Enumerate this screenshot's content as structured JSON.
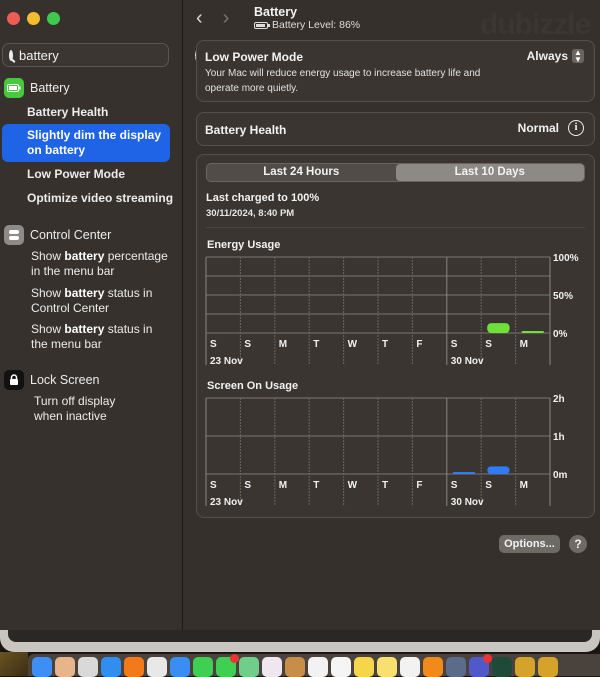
{
  "window": {
    "title": "Battery",
    "subtitle": "Battery Level: 86%",
    "battery_level_percent": 86,
    "traffic_lights": {
      "close": "#ee5c55",
      "minimize": "#f2be2f",
      "zoom": "#3fc94c"
    }
  },
  "sidebar": {
    "search": {
      "value": "battery",
      "placeholder": "Search"
    },
    "sections": [
      {
        "label": "Battery",
        "icon": "battery-icon",
        "icon_color": "#47c93d",
        "items": [
          {
            "label": "Battery Health",
            "selected": false
          },
          {
            "label": "Slightly dim the display on battery",
            "selected": true
          },
          {
            "label": "Low Power Mode",
            "selected": false
          },
          {
            "label": "Optimize video streaming",
            "selected": false
          }
        ]
      },
      {
        "label": "Control Center",
        "icon": "control-center-icon",
        "icon_color": "#8e8a87",
        "items": [
          {
            "pre": "Show ",
            "bold": "battery",
            "post": " percentage in the menu bar"
          },
          {
            "pre": "Show ",
            "bold": "battery",
            "post": " status in Control Center"
          },
          {
            "pre": "Show ",
            "bold": "battery",
            "post": " status in the menu bar"
          }
        ]
      },
      {
        "label": "Lock Screen",
        "icon": "lock-icon",
        "icon_color": "#111111",
        "items": [
          {
            "label": "Turn off display when inactive"
          }
        ]
      }
    ],
    "selected_color": "#1f63e6"
  },
  "low_power": {
    "title": "Low Power Mode",
    "description": "Your Mac will reduce energy usage to increase battery life and operate more quietly.",
    "value": "Always"
  },
  "battery_health": {
    "title": "Battery Health",
    "value": "Normal"
  },
  "usage": {
    "tabs": [
      {
        "label": "Last 24 Hours",
        "active": false
      },
      {
        "label": "Last 10 Days",
        "active": true
      }
    ],
    "last_charged_title": "Last charged to 100%",
    "last_charged_time": "30/11/2024, 8:40 PM"
  },
  "chart_data": [
    {
      "type": "bar",
      "title": "Energy Usage",
      "categories": [
        "S",
        "S",
        "M",
        "T",
        "W",
        "T",
        "F",
        "S",
        "S",
        "M"
      ],
      "date_labels": [
        {
          "index": 0,
          "label": "23 Nov"
        },
        {
          "index": 7,
          "label": "30 Nov"
        }
      ],
      "values": [
        0,
        0,
        0,
        0,
        0,
        0,
        0,
        0,
        13,
        1
      ],
      "unit": "%",
      "y_ticks": [
        "0%",
        "50%",
        "100%"
      ],
      "ylim": [
        0,
        100
      ],
      "color": "#6fe03a",
      "grid": true
    },
    {
      "type": "bar",
      "title": "Screen On Usage",
      "categories": [
        "S",
        "S",
        "M",
        "T",
        "W",
        "T",
        "F",
        "S",
        "S",
        "M"
      ],
      "date_labels": [
        {
          "index": 0,
          "label": "23 Nov"
        },
        {
          "index": 7,
          "label": "30 Nov"
        }
      ],
      "values": [
        0,
        0,
        0,
        0,
        0,
        0,
        0,
        1,
        12,
        0
      ],
      "unit": "minutes",
      "y_ticks": [
        "0m",
        "1h",
        "2h"
      ],
      "ylim": [
        0,
        120
      ],
      "color": "#2f7cf6",
      "grid": true
    }
  ],
  "footer": {
    "options_label": "Options...",
    "help_label": "?"
  },
  "watermark": "dubizzle",
  "dock": {
    "apps": [
      {
        "name": "finder",
        "color": "#3e8ff5"
      },
      {
        "name": "launchpad",
        "color": "#e8b48a"
      },
      {
        "name": "calculator",
        "color": "#d9d9d9"
      },
      {
        "name": "safari",
        "color": "#2f8ef0"
      },
      {
        "name": "firefox",
        "color": "#f27a1a"
      },
      {
        "name": "chrome",
        "color": "#e8e8e8"
      },
      {
        "name": "mail",
        "color": "#3a8ef2"
      },
      {
        "name": "facetime",
        "color": "#3fcf53"
      },
      {
        "name": "messages",
        "color": "#3fcf53",
        "badge": true
      },
      {
        "name": "maps",
        "color": "#6fcf8a"
      },
      {
        "name": "photos",
        "color": "#f0e6f0"
      },
      {
        "name": "contacts",
        "color": "#c98d4a"
      },
      {
        "name": "calendar",
        "color": "#f2f2f2"
      },
      {
        "name": "reminders",
        "color": "#f5f5f5"
      },
      {
        "name": "notes",
        "color": "#f5d54a"
      },
      {
        "name": "stickies",
        "color": "#f8e070"
      },
      {
        "name": "freeform",
        "color": "#f2f2f2"
      },
      {
        "name": "vlc",
        "color": "#f08a1a"
      },
      {
        "name": "quicktime",
        "color": "#5b6b8a"
      },
      {
        "name": "teams",
        "color": "#5059c9",
        "badge": true
      },
      {
        "name": "pycharm",
        "color": "#1f4a3a"
      },
      {
        "name": "nuke-1",
        "color": "#d6a32a"
      },
      {
        "name": "nuke-2",
        "color": "#d6a32a"
      }
    ]
  }
}
